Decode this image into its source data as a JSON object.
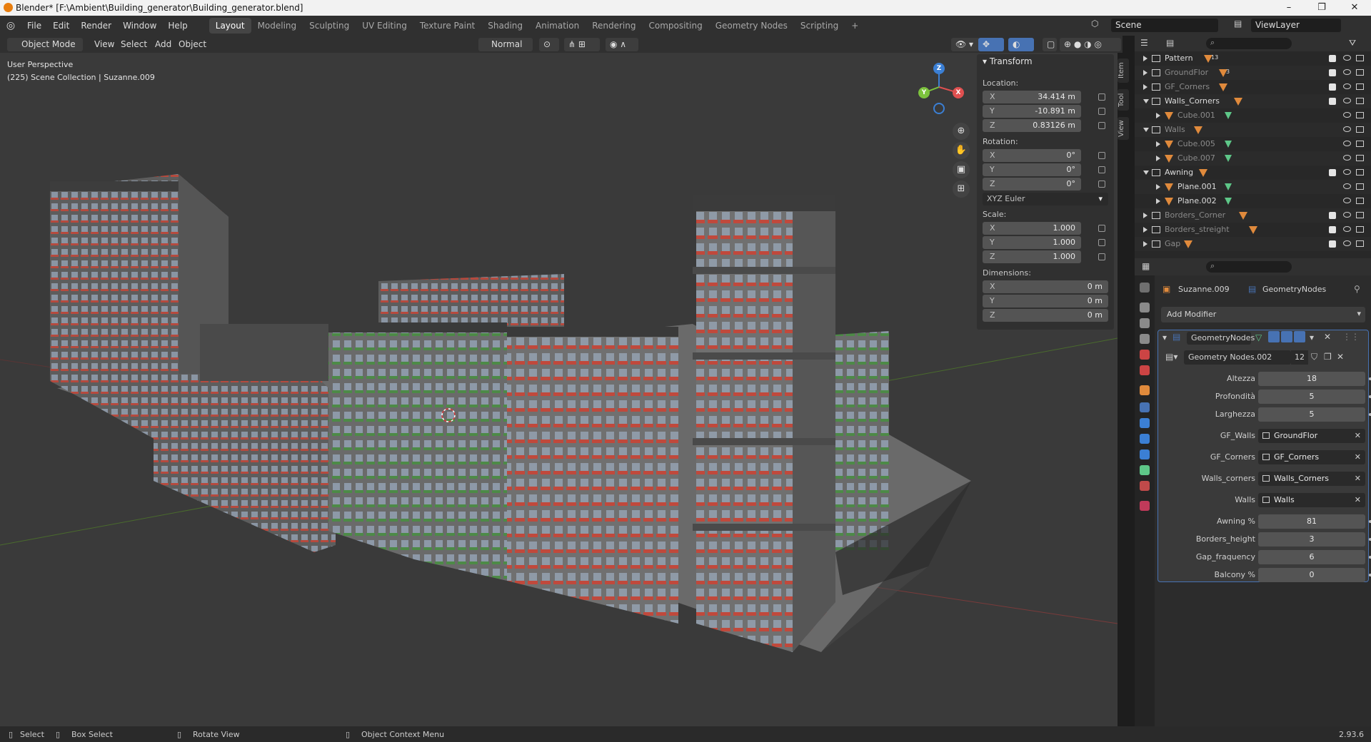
{
  "window": {
    "title": "Blender* [F:\\Ambient\\Building_generator\\Building_generator.blend]",
    "min": "–",
    "max": "❐",
    "close": "✕"
  },
  "menu": [
    "File",
    "Edit",
    "Render",
    "Window",
    "Help"
  ],
  "workspaces": [
    "Layout",
    "Modeling",
    "Sculpting",
    "UV Editing",
    "Texture Paint",
    "Shading",
    "Animation",
    "Rendering",
    "Compositing",
    "Geometry Nodes",
    "Scripting"
  ],
  "active_workspace": "Layout",
  "add_workspace": "+",
  "scene": "Scene",
  "view_layer": "ViewLayer",
  "viewport_header": {
    "mode": "Object Mode",
    "view": "View",
    "select": "Select",
    "add": "Add",
    "object": "Object",
    "orientation": "Normal"
  },
  "viewport": {
    "perspective": "User Perspective",
    "collection": "(225) Scene Collection | Suzanne.009"
  },
  "npanel": {
    "section": "Transform",
    "location_label": "Location:",
    "location": {
      "x": "34.414 m",
      "y": "-10.891 m",
      "z": "0.83126 m"
    },
    "rotation_label": "Rotation:",
    "rotation": {
      "x": "0°",
      "y": "0°",
      "z": "0°"
    },
    "rotation_mode": "XYZ Euler",
    "scale_label": "Scale:",
    "scale": {
      "x": "1.000",
      "y": "1.000",
      "z": "1.000"
    },
    "dimensions_label": "Dimensions:",
    "dimensions": {
      "x": "0 m",
      "y": "0 m",
      "z": "0 m"
    },
    "axis_x": "X",
    "axis_y": "Y",
    "axis_z": "Z"
  },
  "side_tabs": [
    "Item",
    "Tool",
    "View"
  ],
  "outliner": [
    {
      "name": "Pattern",
      "badge": "13"
    },
    {
      "name": "GroundFlor",
      "badge": "3"
    },
    {
      "name": "GF_Corners",
      "badge": ""
    },
    {
      "name": "Walls_Corners",
      "badge": ""
    },
    {
      "name": "Cube.001",
      "badge": ""
    },
    {
      "name": "Walls",
      "badge": ""
    },
    {
      "name": "Cube.005",
      "badge": ""
    },
    {
      "name": "Cube.007",
      "badge": ""
    },
    {
      "name": "Awning",
      "badge": ""
    },
    {
      "name": "Plane.001",
      "badge": ""
    },
    {
      "name": "Plane.002",
      "badge": ""
    },
    {
      "name": "Borders_Corner",
      "badge": ""
    },
    {
      "name": "Borders_streight",
      "badge": ""
    },
    {
      "name": "Gap",
      "badge": ""
    }
  ],
  "properties": {
    "object": "Suzanne.009",
    "modifier_crumb": "GeometryNodes",
    "add_modifier": "Add Modifier",
    "modifier_name": "GeometryNodes",
    "node_group": "Geometry Nodes.002",
    "node_users": "12",
    "inputs": [
      {
        "label": "Altezza",
        "value": "18",
        "type": "num"
      },
      {
        "label": "Profondità",
        "value": "5",
        "type": "num"
      },
      {
        "label": "Larghezza",
        "value": "5",
        "type": "num"
      },
      {
        "label": "GF_Walls",
        "value": "GroundFlor",
        "type": "obj"
      },
      {
        "label": "GF_Corners",
        "value": "GF_Corners",
        "type": "obj"
      },
      {
        "label": "Walls_corners",
        "value": "Walls_Corners",
        "type": "obj"
      },
      {
        "label": "Walls",
        "value": "Walls",
        "type": "obj"
      },
      {
        "label": "Awning %",
        "value": "81",
        "type": "num"
      },
      {
        "label": "Borders_height",
        "value": "3",
        "type": "num"
      },
      {
        "label": "Gap_fraquency",
        "value": "6",
        "type": "num"
      },
      {
        "label": "Balcony %",
        "value": "0",
        "type": "num"
      }
    ]
  },
  "status": {
    "select": "Select",
    "box_select": "Box Select",
    "rotate": "Rotate View",
    "context": "Object Context Menu",
    "version": "2.93.6"
  },
  "colors": {
    "accent_blue": "#4772b3",
    "mesh_orange": "#e08a3c",
    "modifier_green": "#5ec788"
  }
}
